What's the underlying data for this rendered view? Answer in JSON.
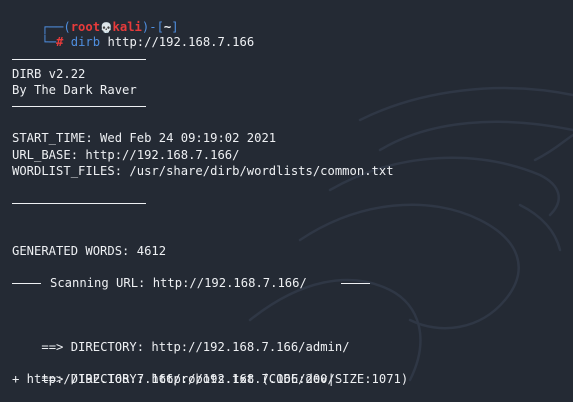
{
  "prompt": {
    "open": "┌──(",
    "user": "root",
    "skull": "💀",
    "host": "kali",
    "mid": ")-[",
    "dir": "~",
    "close": "]",
    "line2": "└─",
    "hash": "#",
    "command_name": "dirb",
    "command_args": "http://192.168.7.166"
  },
  "banner": {
    "version": "DIRB v2.22",
    "author": "By The Dark Raver"
  },
  "info": {
    "start_time": "START_TIME: Wed Feb 24 09:19:02 2021",
    "url_base": "URL_BASE: http://192.168.7.166/",
    "wordlist": "WORDLIST_FILES: /usr/share/dirb/wordlists/common.txt"
  },
  "generated": "GENERATED WORDS: 4612",
  "scanning": "Scanning URL: http://192.168.7.166/",
  "results": {
    "dir1": "DIRECTORY: http://192.168.7.166/admin/",
    "dir2": "DIRECTORY: http://192.168.7.166/dev/",
    "file1": "+ http://192.168.7.166/robots.txt (CODE:200|SIZE:1071)"
  },
  "arrow": "==>"
}
